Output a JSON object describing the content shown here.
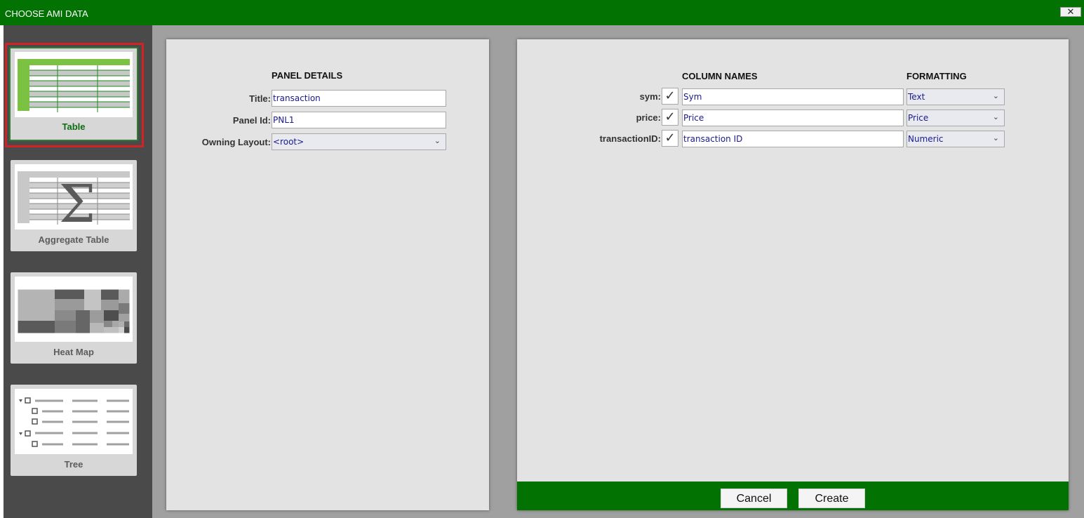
{
  "window": {
    "title": "CHOOSE AMI DATA",
    "close_label": "✕"
  },
  "sidebar": {
    "items": [
      {
        "label": "Table",
        "selected": true,
        "icon": "table-thumbnail"
      },
      {
        "label": "Aggregate Table",
        "selected": false,
        "icon": "aggregate-table-thumbnail"
      },
      {
        "label": "Heat Map",
        "selected": false,
        "icon": "heat-map-thumbnail"
      },
      {
        "label": "Tree",
        "selected": false,
        "icon": "tree-thumbnail"
      }
    ]
  },
  "panel_details": {
    "heading": "PANEL DETAILS",
    "title_label": "Title:",
    "title_value": "transaction",
    "panel_id_label": "Panel Id:",
    "panel_id_value": "PNL1",
    "owning_layout_label": "Owning Layout:",
    "owning_layout_value": "<root>"
  },
  "columns": {
    "names_heading": "COLUMN NAMES",
    "formatting_heading": "FORMATTING",
    "rows": [
      {
        "field": "sym:",
        "checked": true,
        "name": "Sym",
        "format": "Text"
      },
      {
        "field": "price:",
        "checked": true,
        "name": "Price",
        "format": "Price"
      },
      {
        "field": "transactionID:",
        "checked": true,
        "name": "transaction ID",
        "format": "Numeric"
      }
    ]
  },
  "footer": {
    "cancel_label": "Cancel",
    "create_label": "Create"
  },
  "colors": {
    "titlebar": "#027202",
    "sidebar": "#4a4a4a",
    "selected_outline": "#d22222",
    "input_text": "#1a1a8c"
  }
}
